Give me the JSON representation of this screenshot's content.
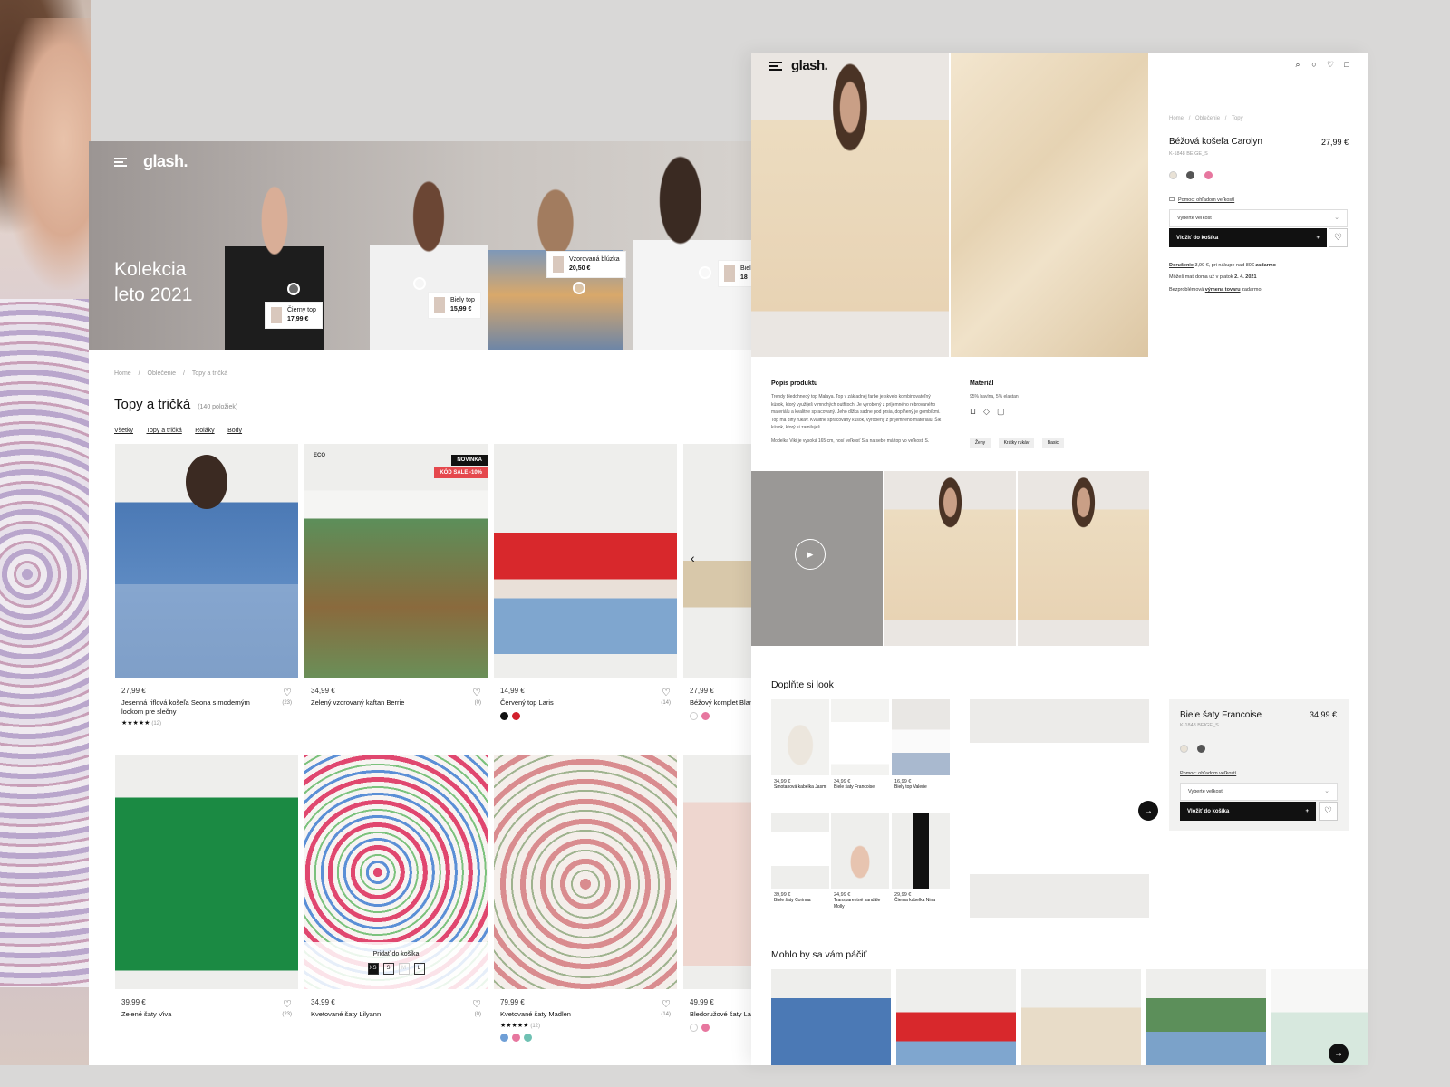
{
  "left_page": {
    "brand": "glash.",
    "hero_title_line1": "Kolekcia",
    "hero_title_line2": "leto 2021",
    "hero_tags": [
      {
        "name": "Čierny top",
        "price": "17,99 €"
      },
      {
        "name": "Biely top",
        "price": "15,99 €"
      },
      {
        "name": "Vzorovaná blúzka",
        "price": "20,50 €"
      },
      {
        "name": "Biel",
        "price": "18"
      }
    ],
    "breadcrumb": [
      "Home",
      "Oblečenie",
      "Topy a tričká"
    ],
    "breadcrumb_sep": "/",
    "title": "Topy a tričká",
    "count": "(140 položiek)",
    "filters": [
      "Všetky",
      "Topy a tričká",
      "Roláky",
      "Body"
    ],
    "filter_sep": "·",
    "products_row1": [
      {
        "price": "27,99 €",
        "name": "Jesenná riflová košeľa Seona s moderným lookom pre slečny",
        "reviews": "(23)",
        "rating": "★★★★★",
        "rating_count": "(12)"
      },
      {
        "price": "34,99 €",
        "name": "Zelený vzorovaný kaftan Berrie",
        "reviews": "(0)",
        "badge1": "NOVINKA",
        "badge2": "KÓD SALE -10%",
        "eco": "ECO"
      },
      {
        "price": "14,99 €",
        "name": "Červený top Laris",
        "reviews": "(14)"
      },
      {
        "price": "27,99 €",
        "name": "Béžový komplet Blan"
      }
    ],
    "products_row2": [
      {
        "price": "39,99 €",
        "name": "Zelené šaty Viva",
        "reviews": "(23)"
      },
      {
        "price": "34,99 €",
        "name": "Kvetované šaty Lilyann",
        "reviews": "(0)",
        "quick_add": "Pridať do košíka",
        "sizes": [
          "XS",
          "S",
          "M",
          "L"
        ]
      },
      {
        "price": "79,99 €",
        "name": "Kvetované šaty Madlen",
        "reviews": "(14)",
        "rating": "★★★★★",
        "rating_count": "(12)"
      },
      {
        "price": "49,99 €",
        "name": "Bledoružové šaty La"
      }
    ],
    "colors": {
      "black": "#111111",
      "red": "#d2202c",
      "white": "#ffffff",
      "pink": "#e7779f",
      "blue": "#6f9fd6",
      "teal": "#6fc1b3",
      "sale": "#e5484d"
    }
  },
  "right_page": {
    "brand": "glash.",
    "header_icons": [
      "search-icon",
      "user-icon",
      "heart-icon",
      "bag-icon"
    ],
    "bag_count": "0",
    "breadcrumb": [
      "Home",
      "Oblečenie",
      "Topy"
    ],
    "product_title": "Béžová košeľa Carolyn",
    "product_price": "27,99 €",
    "sku": "K-1848 BEIGE_S",
    "size_help": "Pomoc: ohľadom veľkostí",
    "size_select": "Vyberte veľkosť",
    "add_to_cart": "Vložiť do košíka",
    "plus": "+",
    "delivery_label": "Doručenie",
    "delivery_text": "3,99 €, pri nákupe nad 80€",
    "delivery_free": "zadarmo",
    "delivery_date_text": "Môžeš mať doma už v piatok",
    "delivery_date": "2. 4. 2021",
    "returns_prefix": "Bezproblémová",
    "returns_link": "výmena tovaru",
    "returns_suffix": "zadarmo",
    "desc_title": "Popis produktu",
    "desc_text": "Trendy bledohnedý top Malaya. Top v základnej farbe je skvelo kombinovateľný kúsok, ktorý využiješ v mnohých outfitoch. Je vyrobený z príjemného rebrovaného materiálu a kvalitne spracovaný. Jeho dĺžka sadne pod prsia, dopĺňený je gombíkmi. Top má dlhý rukáv. Kvalitne spracovaný kúsok, vyrobený z príjemného materiálu. Šik kúsok, ktorý si zamiluješ.",
    "desc_model": "Modelka Viki je vysoká 165 cm, nosí veľkosť S a na sebe má top vo veľkosti S.",
    "material_title": "Materiál",
    "material_text": "95% bavlna, 5% elastan",
    "chips": [
      "Ženy",
      "Krátky rukáv",
      "Basic"
    ],
    "complete_look_title": "Doplňte si look",
    "look_items": [
      {
        "price": "34,99 €",
        "name": "Smotanová kabelka Jasmi"
      },
      {
        "price": "34,99 €",
        "name": "Biele šaty Francoise"
      },
      {
        "price": "16,99 €",
        "name": "Biely top Valerie"
      },
      {
        "price": "39,99 €",
        "name": "Biele šaty Corinna"
      },
      {
        "price": "24,99 €",
        "name": "Transparentné sandále Molly"
      },
      {
        "price": "29,99 €",
        "name": "Čierna kabelka Nina"
      }
    ],
    "look_detail": {
      "title": "Biele šaty Francoise",
      "price": "34,99 €",
      "sku": "K-1848 BEIGE_S",
      "size_help": "Pomoc: ohľadom veľkostí",
      "size_select": "Vyberte veľkosť",
      "add_to_cart": "Vložiť do košíka"
    },
    "maybe_title": "Mohlo by sa vám páčiť",
    "arrow": "→",
    "play": "▶",
    "colors": {
      "beige": "#e9e2d6",
      "grey": "#555555",
      "pink": "#e7779f",
      "black": "#111111"
    }
  }
}
